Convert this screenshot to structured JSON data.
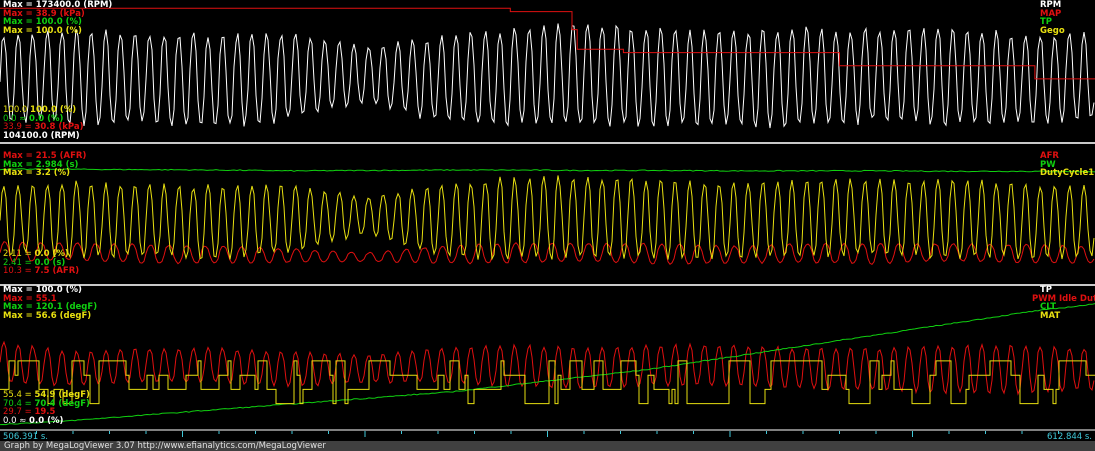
{
  "colors": {
    "white": "#ffffff",
    "red": "#e01010",
    "green": "#10d010",
    "yellow": "#e8e010",
    "cyan": "#3fc8d8"
  },
  "chart_data": [
    {
      "type": "line",
      "title": "Panel 1",
      "x_range": [
        506.391,
        612.844
      ],
      "series": [
        {
          "name": "RPM",
          "color": "#ffffff",
          "max_label": "Max = 173400.0 (RPM)",
          "min_label": "104100.0 (RPM)",
          "ylim": [
            104100,
            173400
          ],
          "cycles": 75,
          "center": [
            135000,
            136000,
            135000,
            134000,
            136000,
            137000,
            135000,
            136000,
            137000,
            136000,
            135000,
            136000,
            137000,
            136000,
            135000,
            136000
          ],
          "amplitude": [
            22000,
            24000,
            23000,
            24000,
            22000,
            14000,
            22000,
            25000,
            26000,
            25000,
            24000,
            25000,
            24000,
            25000,
            23000,
            22000
          ]
        },
        {
          "name": "MAP",
          "color": "#e01010",
          "max_label": "Max = 38.9 (kPa)",
          "min_label": "30.8 (kPa)",
          "min_prefix": "33.9 =",
          "ylim": [
            30.8,
            38.9
          ],
          "steps": [
            [
              506.391,
              38.7
            ],
            [
              556,
              38.5
            ],
            [
              562,
              37.4
            ],
            [
              562.5,
              36.2
            ],
            [
              567,
              36.0
            ],
            [
              588,
              35.2
            ],
            [
              601,
              35.2
            ],
            [
              607,
              34.4
            ],
            [
              612.844,
              34.4
            ]
          ]
        },
        {
          "name": "TP",
          "color": "#10d010",
          "max_label": "Max = 100.0 (%)",
          "min_label": "0.0 (%)",
          "min_prefix": "0.0 ≈"
        },
        {
          "name": "Gego",
          "color": "#e8e010",
          "max_label": "Max = 100.0 (%)",
          "min_label": "100.0 (%)",
          "min_prefix": "100.0"
        }
      ]
    },
    {
      "type": "line",
      "title": "Panel 2",
      "x_range": [
        506.391,
        612.844
      ],
      "series": [
        {
          "name": "AFR",
          "color": "#e01010",
          "max_label": "Max = 21.5 (AFR)",
          "min_label": "7.5 (AFR)",
          "min_prefix": "10.3 =",
          "ylim": [
            7.5,
            21.5
          ],
          "cycles": 60,
          "center": [
            10.8,
            10.9,
            10.6,
            10.5,
            10.4,
            10.2,
            10.5,
            10.7,
            10.8,
            10.6,
            10.5,
            10.7,
            10.6,
            10.8,
            10.6,
            10.5
          ],
          "amplitude": [
            1.2,
            1.0,
            1.1,
            1.0,
            0.8,
            0.5,
            1.0,
            1.2,
            1.1,
            1.2,
            1.0,
            1.1,
            1.2,
            1.0,
            1.1,
            1.0
          ]
        },
        {
          "name": "PW",
          "color": "#10d010",
          "max_label": "Max = 2.984 (s)",
          "min_label": "0.0 (s)",
          "min_prefix": "2.41 =",
          "ylim": [
            0,
            2.984
          ],
          "flat": [
            2.8,
            2.8,
            2.79,
            2.78,
            2.76,
            2.77,
            2.78,
            2.78,
            2.77,
            2.77,
            2.76,
            2.76,
            2.76,
            2.75,
            2.75,
            2.74
          ]
        },
        {
          "name": "DutyCycle1",
          "color": "#e8e010",
          "max_label": "Max = 3.2 (%)",
          "min_label": "0.0 (%)",
          "min_prefix": "2.11 =",
          "ylim": [
            0,
            3.2
          ],
          "cycles": 75,
          "center": [
            1.6,
            1.65,
            1.6,
            1.55,
            1.65,
            1.75,
            1.6,
            1.65,
            1.7,
            1.65,
            1.6,
            1.65,
            1.7,
            1.65,
            1.6,
            1.6
          ],
          "amplitude": [
            0.9,
            1.0,
            0.95,
            1.0,
            0.9,
            0.5,
            0.95,
            1.1,
            1.1,
            1.05,
            1.0,
            1.05,
            1.0,
            1.05,
            1.0,
            0.95
          ]
        }
      ]
    },
    {
      "type": "line",
      "title": "Panel 3",
      "x_range": [
        506.391,
        612.844
      ],
      "series": [
        {
          "name": "TP",
          "color": "#ffffff",
          "max_label": "Max = 100.0 (%)",
          "min_label": "0.0 (%)",
          "min_prefix": "0.0 ≈"
        },
        {
          "name": "PWM Idle Duty",
          "color": "#e01010",
          "max_label": "Max = 55.1",
          "min_label": "19.5",
          "min_prefix": "29.7 =",
          "ylim": [
            19.5,
            55.1
          ],
          "cycles": 75,
          "center": [
            38,
            36,
            37,
            37,
            36,
            36,
            37,
            37,
            36,
            37,
            37,
            36,
            36,
            36,
            36,
            36
          ],
          "amplitude": [
            6,
            5,
            5,
            5,
            5,
            4,
            5,
            6,
            6,
            6,
            6,
            6,
            6,
            7,
            7,
            6
          ]
        },
        {
          "name": "CLT",
          "color": "#10d010",
          "max_label": "Max = 120.1 (degF)",
          "min_label": "70.4 (degF)",
          "min_prefix": "70.4 =",
          "ylim": [
            70.4,
            120.1
          ],
          "flat": [
            70.6,
            72,
            74,
            76,
            78,
            80,
            82,
            84,
            87,
            90,
            93,
            97,
            101,
            105,
            109,
            113,
            117,
            120.1
          ]
        },
        {
          "name": "MAT",
          "color": "#e8e010",
          "max_label": "Max = 56.6 (degF)",
          "min_label": "54.9 (degF)",
          "min_prefix": "55.4 =",
          "ylim": [
            54.9,
            56.6
          ],
          "levels": [
            55.2,
            55.4,
            55.6,
            55.8
          ]
        }
      ]
    }
  ],
  "axis": {
    "start": "506.391 s.",
    "end": "612.844 s."
  },
  "footer": "Graph by MegaLogViewer 3.07 http://www.efianalytics.com/MegaLogViewer"
}
